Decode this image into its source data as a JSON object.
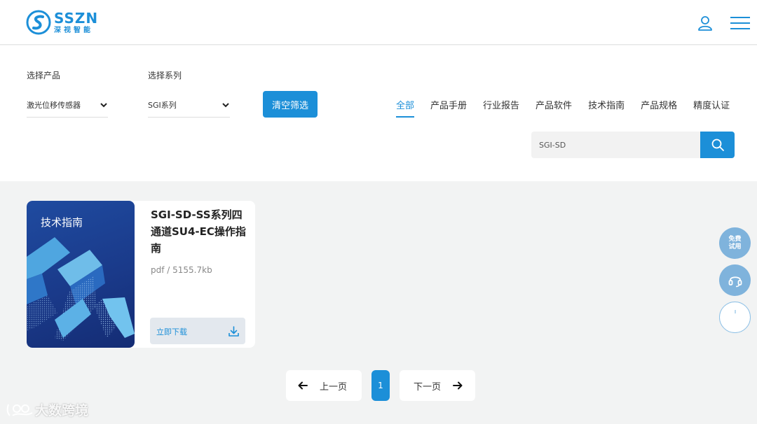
{
  "header": {
    "logo_en": "SSZN",
    "logo_cn": "深视智能"
  },
  "filter": {
    "product_label": "选择产品",
    "product_value": "激光位移传感器",
    "series_label": "选择系列",
    "series_value": "SGI系列",
    "clear_button": "清空筛选",
    "tabs": [
      {
        "label": "全部",
        "active": true
      },
      {
        "label": "产品手册",
        "active": false
      },
      {
        "label": "行业报告",
        "active": false
      },
      {
        "label": "产品软件",
        "active": false
      },
      {
        "label": "技术指南",
        "active": false
      },
      {
        "label": "产品规格",
        "active": false
      },
      {
        "label": "精度认证",
        "active": false
      }
    ],
    "search_value": "SGI-SD"
  },
  "documents": [
    {
      "cover_label": "技术指南",
      "title": "SGI-SD-SS系列四通道SU4-EC操作指南",
      "meta": "pdf / 5155.7kb",
      "download_label": "立即下载"
    }
  ],
  "side": {
    "trial_line1": "免费",
    "trial_line2": "试用"
  },
  "pagination": {
    "prev_label": "上一页",
    "current": "1",
    "next_label": "下一页"
  },
  "watermark": "大数跨境",
  "colors": {
    "accent": "#1c8fd8",
    "background": "#f2f3f3"
  }
}
